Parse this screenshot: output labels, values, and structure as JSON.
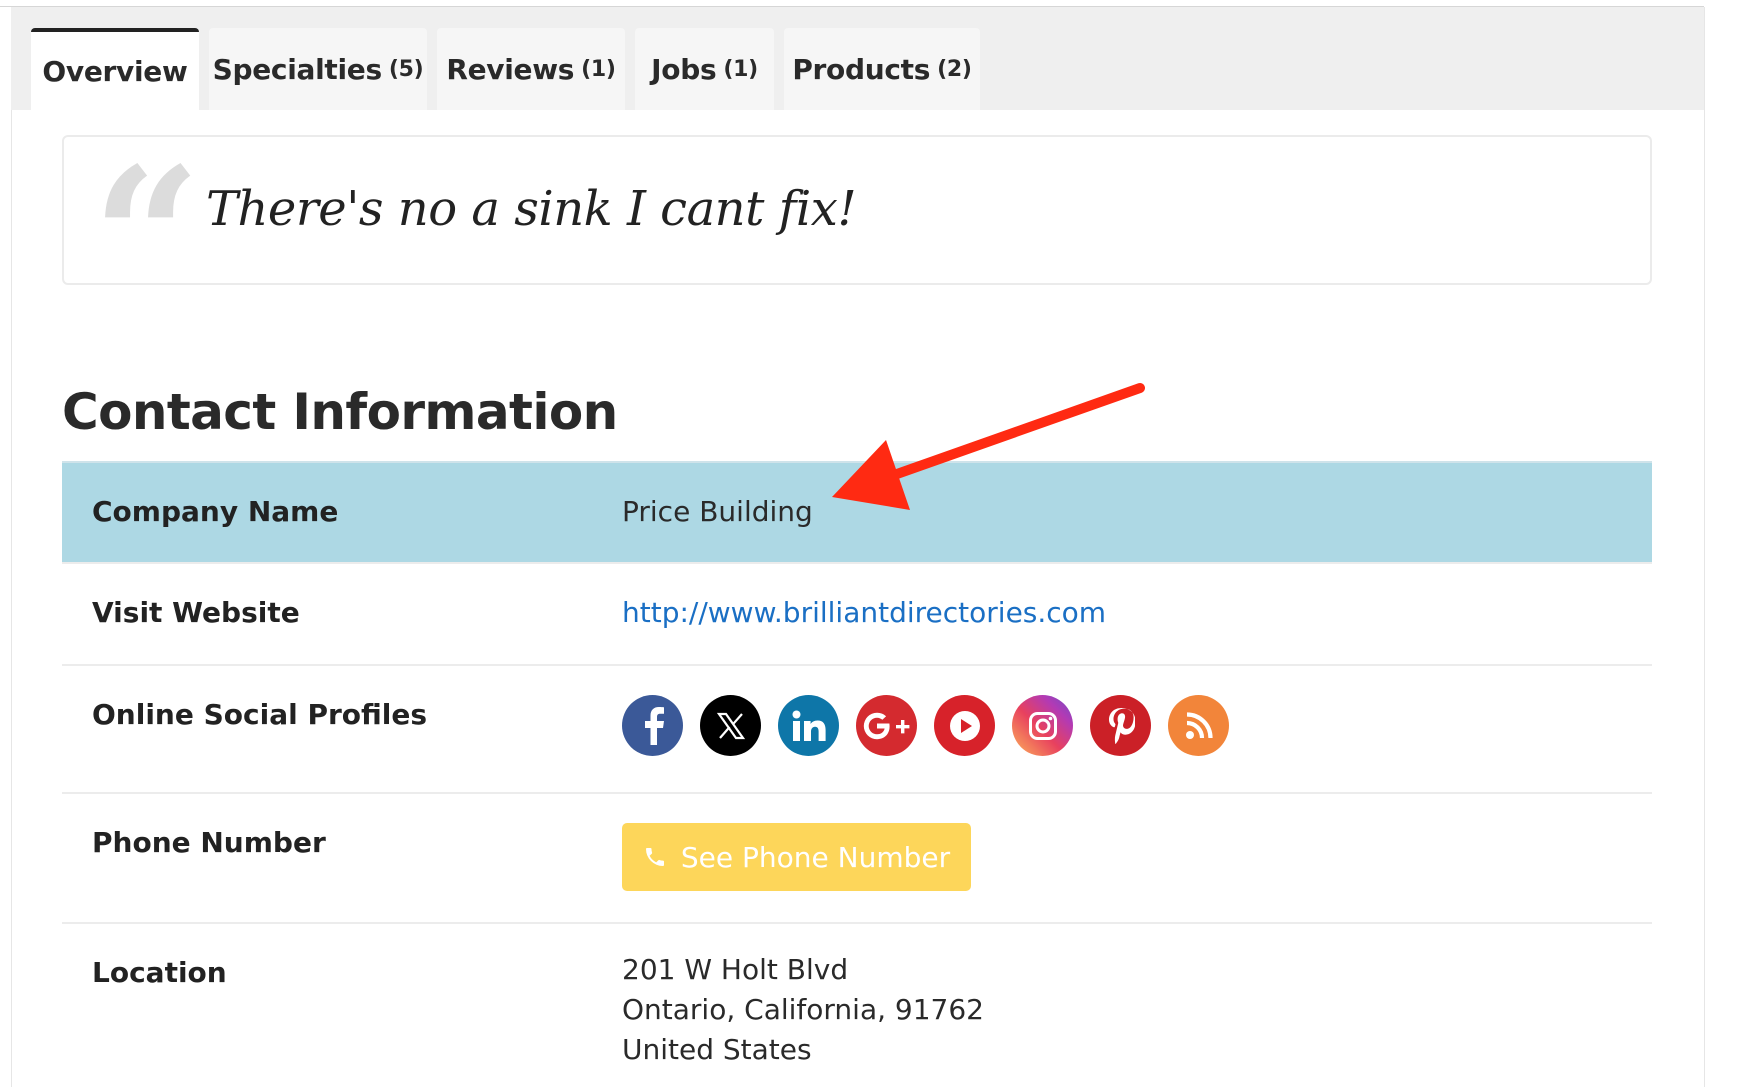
{
  "tabs": [
    {
      "label": "Overview",
      "count": ""
    },
    {
      "label": "Specialties",
      "count": "(5)"
    },
    {
      "label": "Reviews",
      "count": "(1)"
    },
    {
      "label": "Jobs",
      "count": "(1)"
    },
    {
      "label": "Products",
      "count": "(2)"
    }
  ],
  "active_tab": "Overview",
  "quote": {
    "mark": "“",
    "text": "There's no a sink I cant fix!"
  },
  "contact": {
    "title": "Contact Information",
    "company": {
      "label": "Company Name",
      "value": "Price Building"
    },
    "website": {
      "label": "Visit Website",
      "value": "http://www.brilliantdirectories.com"
    },
    "social": {
      "label": "Online Social Profiles",
      "icons": [
        "facebook-icon",
        "x-twitter-icon",
        "linkedin-icon",
        "google-plus-icon",
        "youtube-icon",
        "instagram-icon",
        "pinterest-icon",
        "rss-icon"
      ],
      "colors": {
        "facebook": "#3b5998",
        "x": "#000000",
        "linkedin": "#0e76a8",
        "google_plus": "#d42a2f",
        "youtube": "#d7222a",
        "instagram": "#c13584",
        "pinterest": "#cb2027",
        "rss": "#f2853a"
      }
    },
    "phone": {
      "label": "Phone Number",
      "button": "See Phone Number",
      "button_color": "#fdd65a"
    },
    "location": {
      "label": "Location",
      "line1": "201 W Holt Blvd",
      "line2": "Ontario, California, 91762",
      "line3": "United States"
    }
  },
  "annotation": {
    "type": "arrow",
    "color": "#ff2a12"
  }
}
